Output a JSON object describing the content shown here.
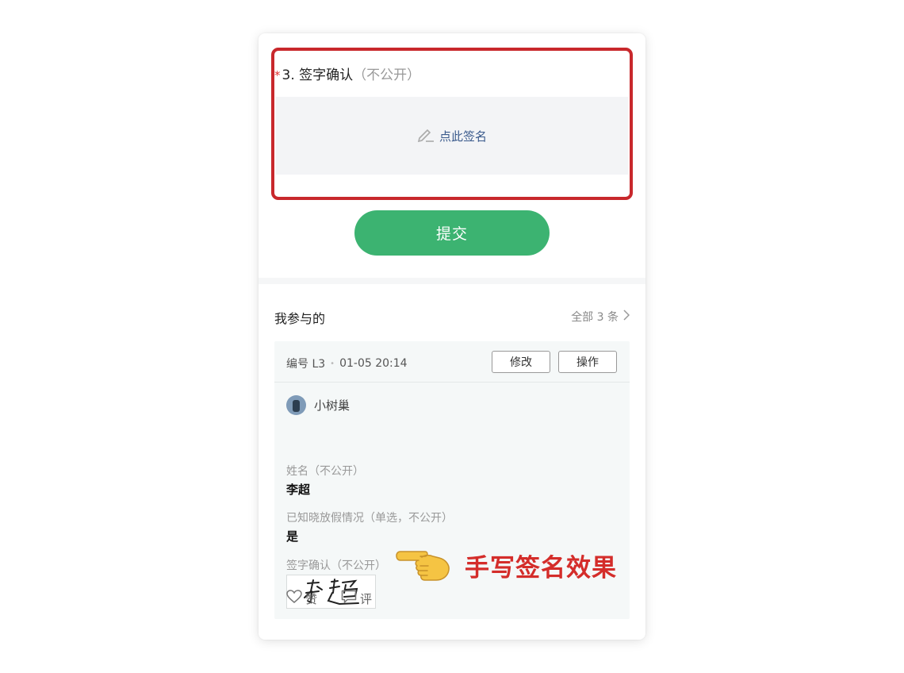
{
  "form": {
    "question_required_mark": "*",
    "question_title": "3. 签字确认",
    "question_hint": "（不公开）",
    "sign_button_label": "点此签名",
    "submit_label": "提交"
  },
  "participated": {
    "section_title": "我参与的",
    "view_all_label": "全部 3 条",
    "entry": {
      "number": "编号 L3",
      "separator": "•",
      "timestamp": "01-05 20:14",
      "edit_label": "修改",
      "operate_label": "操作",
      "username": "小树巢",
      "fields": [
        {
          "label": "姓名（不公开）",
          "value": "李超"
        },
        {
          "label": "已知晓放假情况（单选，不公开）",
          "value": "是"
        },
        {
          "label": "签字确认（不公开）",
          "value": "李超"
        }
      ],
      "like_label": "赞",
      "comment_label": "评"
    }
  },
  "annotation": {
    "text": "手写签名效果",
    "icon": "pointing-hand-icon"
  },
  "colors": {
    "accent_green": "#3cb371",
    "highlight_red": "#c8282c",
    "annotation_red": "#d42d2a",
    "link_blue": "#3a5a8c"
  }
}
